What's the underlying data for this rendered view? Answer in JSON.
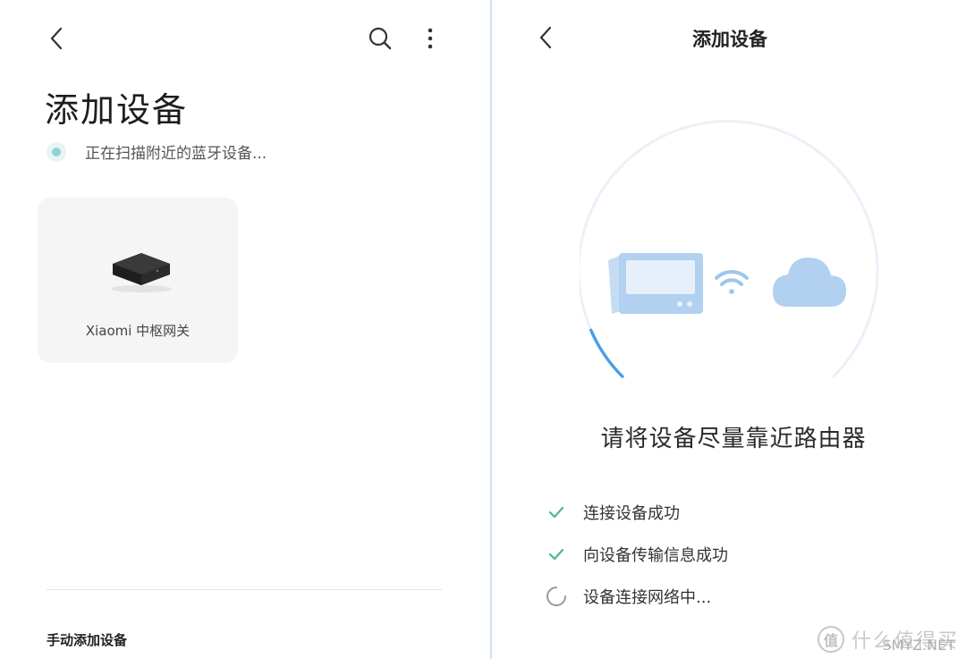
{
  "left": {
    "title": "添加设备",
    "scan_status": "正在扫描附近的蓝牙设备...",
    "device": {
      "name": "Xiaomi 中枢网关",
      "icon": "gateway-device-icon"
    },
    "manual_section_title": "手动添加设备",
    "icons": {
      "back": "back-chevron-icon",
      "search": "search-icon",
      "more": "more-vertical-icon"
    }
  },
  "right": {
    "title": "添加设备",
    "hint": "请将设备尽量靠近路由器",
    "progress": 0.08,
    "steps": [
      {
        "label": "连接设备成功",
        "status": "done"
      },
      {
        "label": "向设备传输信息成功",
        "status": "done"
      },
      {
        "label": "设备连接网络中...",
        "status": "loading"
      }
    ]
  },
  "watermark": {
    "text": "什么值得买",
    "sub": "SMYZ.NET"
  },
  "colors": {
    "accent_blue": "#4a9ee8",
    "check_green": "#4cb69a",
    "scan_teal": "#8fd5cf",
    "divider_blue": "#cfe3f7",
    "card_bg": "#f5f5f5"
  }
}
